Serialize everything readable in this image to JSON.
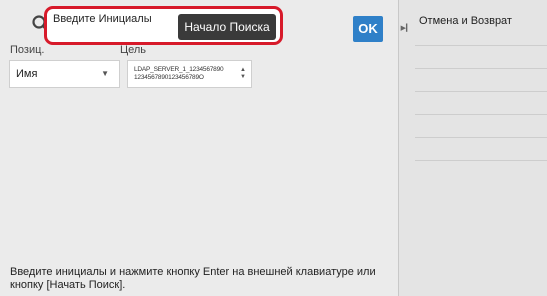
{
  "search": {
    "placeholder": "Введите Инициалы",
    "start_button_label": "Начало Поиска"
  },
  "columns": {
    "position_label": "Позиц.",
    "second_label": "Цель"
  },
  "filters": {
    "field_selected": "Имя",
    "server_selected_line1": "LDAP_SERVER_1_1234567890",
    "server_selected_line2": "1234567890123456789O"
  },
  "hint": "Введите инициалы и нажмите кнопку Enter на внешней клавиатуре или кнопку [Начать Поиск].",
  "ok_label": "OK",
  "side_panel": {
    "items": [
      {
        "label": "Отмена и Возврат"
      },
      {
        "label": ""
      },
      {
        "label": ""
      },
      {
        "label": ""
      },
      {
        "label": ""
      },
      {
        "label": ""
      }
    ]
  },
  "icons": {
    "search": "search-icon",
    "collapse": "collapse-arrow-icon",
    "dropdown": "chevron-down-icon",
    "spinner": "up-down-icon"
  },
  "colors": {
    "highlight": "#d71a2a",
    "ok_button": "#2f80c8",
    "start_button": "#3a3a3a"
  }
}
